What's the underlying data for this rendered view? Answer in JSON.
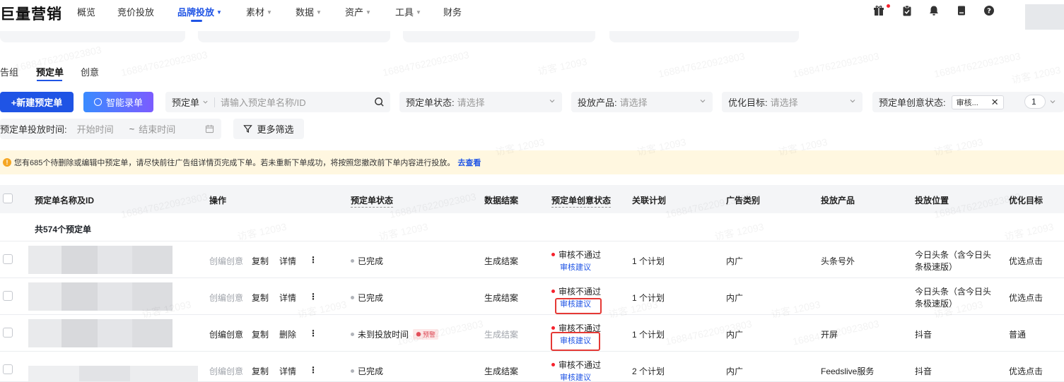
{
  "brand": {
    "logo": "巨量营销"
  },
  "nav": {
    "items": [
      {
        "label": "概览",
        "caret": false
      },
      {
        "label": "竞价投放",
        "caret": false
      },
      {
        "label": "品牌投放",
        "caret": true,
        "active": true
      },
      {
        "label": "素材",
        "caret": true
      },
      {
        "label": "数据",
        "caret": true
      },
      {
        "label": "资产",
        "caret": true
      },
      {
        "label": "工具",
        "caret": true
      },
      {
        "label": "财务",
        "caret": false
      }
    ],
    "caret_glyph": "▼",
    "toolbar_icons": [
      "gift-icon",
      "clipboard-icon",
      "bell-icon",
      "document-icon",
      "help-icon"
    ]
  },
  "tabs": [
    {
      "label": "告组"
    },
    {
      "label": "预定单",
      "active": true
    },
    {
      "label": "创意"
    }
  ],
  "filters": {
    "new_button": "+新建预定单",
    "ai_button": "智能录单",
    "search_type": "预定单",
    "search_placeholder": "请输入预定单名称/ID",
    "status_label": "预定单状态:",
    "status_placeholder": "请选择",
    "product_label": "投放产品:",
    "product_placeholder": "请选择",
    "goal_label": "优化目标:",
    "goal_placeholder": "请选择",
    "creative_status_label": "预定单创意状态:",
    "creative_status_value": "审核...",
    "creative_status_count": "1",
    "time_label": "预定单投放时间:",
    "time_start": "开始时间",
    "time_tilde": "~",
    "time_end": "结束时间",
    "more_filters": "更多筛选",
    "clear_glyph": "✕"
  },
  "notice": {
    "text": "您有685个待删除或编辑中预定单，请尽快前往广告组详情页完成下单。若未重新下单成功，将按照您撤改前下单内容进行投放。",
    "link": "去查看",
    "icon_glyph": "!"
  },
  "table": {
    "headers": {
      "name": "预定单名称及ID",
      "actions": "操作",
      "status": "预定单状态",
      "settlement": "数据结案",
      "creative_status": "预定单创意状态",
      "plans": "关联计划",
      "ad_type": "广告类别",
      "product": "投放产品",
      "placement": "投放位置",
      "goal": "优化目标"
    },
    "total": "共574个预定单",
    "rows": [
      {
        "actions": [
          "创编创意",
          "复制",
          "详情"
        ],
        "status": "已完成",
        "settlement": "生成结案",
        "creative_status": "审核不通过",
        "review_link": "审核建议",
        "plans": "1 个计划",
        "ad_type": "内广",
        "product": "头条号外",
        "placement": "今日头条（含今日头条极速版）",
        "placement_line1": "今日头条（含今日头",
        "placement_line2": "条极速版）",
        "goal": "优选点击"
      },
      {
        "actions": [
          "创编创意",
          "复制",
          "详情"
        ],
        "status": "已完成",
        "settlement": "生成结案",
        "creative_status": "审核不通过",
        "review_link": "审核建议",
        "plans": "1 个计划",
        "ad_type": "内广",
        "product": "",
        "placement": "今日头条（含今日头条极速版）",
        "placement_line1": "今日头条（含今日头",
        "placement_line2": "条极速版）",
        "goal": "优选点击"
      },
      {
        "actions": [
          "创编创意",
          "复制",
          "删除"
        ],
        "status": "未到投放时间",
        "warn_tag": "预警",
        "settlement": "生成结案",
        "creative_status": "审核不通过",
        "review_link": "审核建议",
        "plans": "1 个计划",
        "ad_type": "内广",
        "product": "开屏",
        "placement": "抖音",
        "goal": "普通"
      },
      {
        "actions": [
          "创编创意",
          "复制",
          "详情"
        ],
        "status": "已完成",
        "settlement": "生成结案",
        "creative_status": "审核不通过",
        "review_link": "审核建议",
        "plans": "2 个计划",
        "ad_type": "内广",
        "product": "Feedslive服务",
        "placement": "抖音",
        "goal": "优选点击"
      }
    ],
    "kebab_glyph": "⋮"
  },
  "watermark": {
    "id_text": "1688476220923803",
    "visitor_text": "访客 12093"
  },
  "colors": {
    "primary": "#1f54e5",
    "danger": "#e53935",
    "notice_bg": "#fff7e0"
  }
}
